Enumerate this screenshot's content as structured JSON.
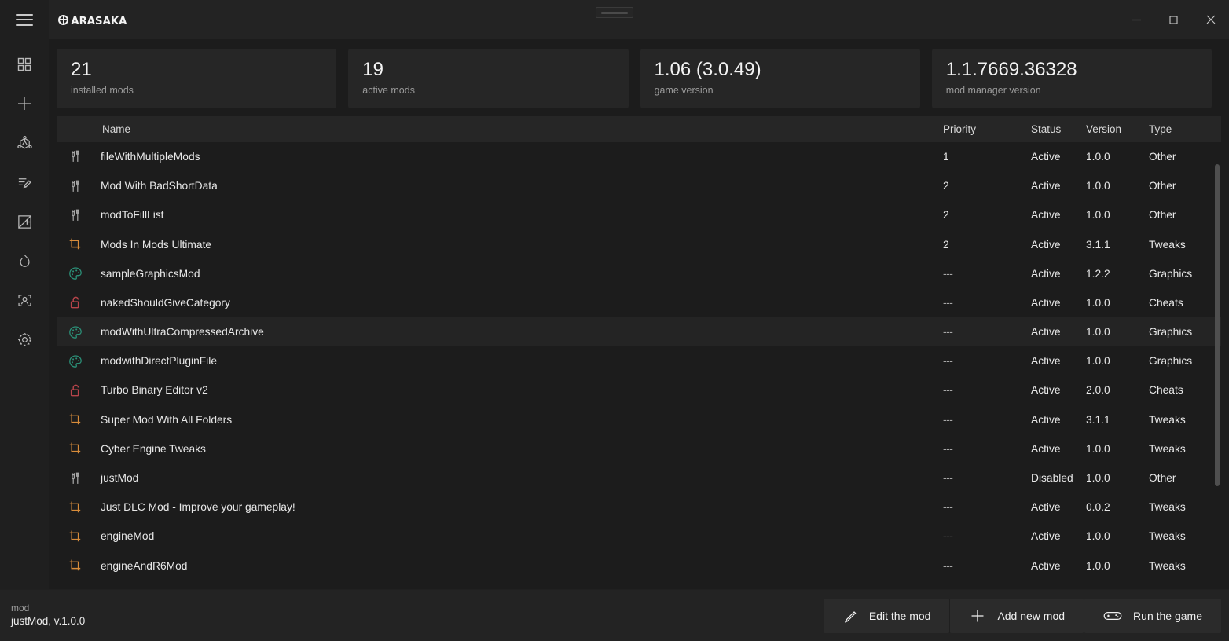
{
  "window": {
    "logo_text": "arasaka",
    "menu_icon": "hamburger-icon",
    "grip_icon": "drag-grip-icon",
    "minimize_label": "Minimize",
    "maximize_label": "Maximize",
    "close_label": "Close"
  },
  "sidebar": {
    "items": [
      {
        "name": "dashboard",
        "icon": "grid-icon"
      },
      {
        "name": "add",
        "icon": "plus-icon"
      },
      {
        "name": "objects",
        "icon": "cube-node-icon"
      },
      {
        "name": "scripts",
        "icon": "pen-list-icon"
      },
      {
        "name": "drafting",
        "icon": "ruler-pencil-icon"
      },
      {
        "name": "performance",
        "icon": "flame-icon"
      },
      {
        "name": "profile",
        "icon": "person-scan-icon"
      },
      {
        "name": "settings",
        "icon": "gear-icon"
      }
    ]
  },
  "stats": [
    {
      "value": "21",
      "label": "installed mods"
    },
    {
      "value": "19",
      "label": "active mods"
    },
    {
      "value": "1.06 (3.0.49)",
      "label": "game version"
    },
    {
      "value": "1.1.7669.36328",
      "label": "mod manager version"
    }
  ],
  "table": {
    "columns": {
      "name": "Name",
      "priority": "Priority",
      "status": "Status",
      "version": "Version",
      "type": "Type"
    },
    "rows": [
      {
        "icon": "other-icon",
        "name": "fileWithMultipleMods",
        "priority": "1",
        "status": "Active",
        "version": "1.0.0",
        "type": "Other",
        "hovered": false
      },
      {
        "icon": "other-icon",
        "name": "Mod With BadShortData",
        "priority": "2",
        "status": "Active",
        "version": "1.0.0",
        "type": "Other",
        "hovered": false
      },
      {
        "icon": "other-icon",
        "name": "modToFillList",
        "priority": "2",
        "status": "Active",
        "version": "1.0.0",
        "type": "Other",
        "hovered": false
      },
      {
        "icon": "tweaks-icon",
        "name": "Mods In Mods Ultimate",
        "priority": "2",
        "status": "Active",
        "version": "3.1.1",
        "type": "Tweaks",
        "hovered": false
      },
      {
        "icon": "graphics-icon",
        "name": "sampleGraphicsMod",
        "priority": "---",
        "status": "Active",
        "version": "1.2.2",
        "type": "Graphics",
        "hovered": false
      },
      {
        "icon": "cheats-icon",
        "name": "nakedShouldGiveCategory",
        "priority": "---",
        "status": "Active",
        "version": "1.0.0",
        "type": "Cheats",
        "hovered": false
      },
      {
        "icon": "graphics-icon",
        "name": "modWithUltraCompressedArchive",
        "priority": "---",
        "status": "Active",
        "version": "1.0.0",
        "type": "Graphics",
        "hovered": true
      },
      {
        "icon": "graphics-icon",
        "name": "modwithDirectPluginFile",
        "priority": "---",
        "status": "Active",
        "version": "1.0.0",
        "type": "Graphics",
        "hovered": false
      },
      {
        "icon": "cheats-icon",
        "name": "Turbo Binary Editor v2",
        "priority": "---",
        "status": "Active",
        "version": "2.0.0",
        "type": "Cheats",
        "hovered": false
      },
      {
        "icon": "tweaks-icon",
        "name": "Super Mod With All Folders",
        "priority": "---",
        "status": "Active",
        "version": "3.1.1",
        "type": "Tweaks",
        "hovered": false
      },
      {
        "icon": "tweaks-icon",
        "name": "Cyber Engine Tweaks",
        "priority": "---",
        "status": "Active",
        "version": "1.0.0",
        "type": "Tweaks",
        "hovered": false
      },
      {
        "icon": "other-icon",
        "name": "justMod",
        "priority": "---",
        "status": "Disabled",
        "version": "1.0.0",
        "type": "Other",
        "hovered": false
      },
      {
        "icon": "tweaks-icon",
        "name": "Just DLC Mod - Improve your gameplay!",
        "priority": "---",
        "status": "Active",
        "version": "0.0.2",
        "type": "Tweaks",
        "hovered": false
      },
      {
        "icon": "tweaks-icon",
        "name": "engineMod",
        "priority": "---",
        "status": "Active",
        "version": "1.0.0",
        "type": "Tweaks",
        "hovered": false
      },
      {
        "icon": "tweaks-icon",
        "name": "engineAndR6Mod",
        "priority": "---",
        "status": "Active",
        "version": "1.0.0",
        "type": "Tweaks",
        "hovered": false
      }
    ]
  },
  "footer": {
    "selected_label": "mod",
    "selected_value": "justMod, v.1.0.0",
    "buttons": [
      {
        "label": "Edit the mod",
        "icon": "pencil-icon"
      },
      {
        "label": "Add new mod",
        "icon": "plus-icon"
      },
      {
        "label": "Run the game",
        "icon": "gamepad-icon"
      }
    ]
  },
  "colors": {
    "window_bg": "#1c1c1c",
    "panel_bg": "#262626",
    "sidebar_bg": "#1f1f1f",
    "titlebar_bg": "#232323",
    "accent_tweaks": "#d88c3a",
    "accent_graphics": "#2b8f77",
    "accent_cheats": "#b6444a",
    "accent_other": "#a6a6a6",
    "text_primary": "#ececec",
    "text_muted": "#9a9a9a"
  }
}
